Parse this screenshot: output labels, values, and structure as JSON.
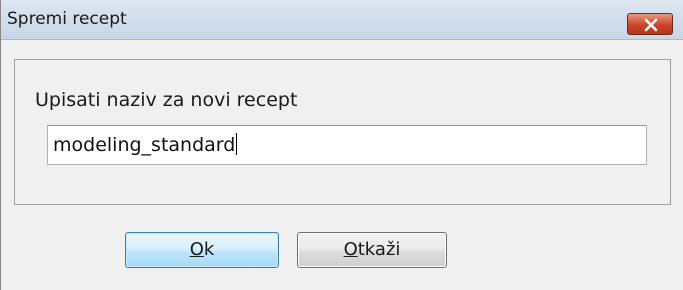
{
  "window": {
    "title": "Spremi recept",
    "close_icon": "close-icon"
  },
  "form": {
    "prompt": "Upisati naziv za novi recept",
    "name_value": "modeling_standard"
  },
  "buttons": {
    "ok_mnemonic": "O",
    "ok_rest": "k",
    "cancel_mnemonic": "O",
    "cancel_rest": "tkaži"
  }
}
